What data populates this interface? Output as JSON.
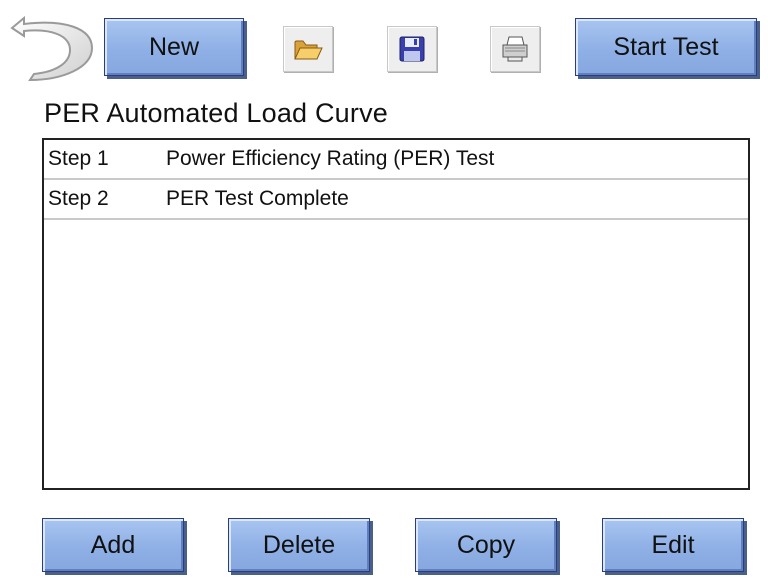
{
  "toolbar": {
    "back_icon": "back-arrow-icon",
    "new_label": "New",
    "open_icon": "folder-open-icon",
    "save_icon": "floppy-disk-icon",
    "print_icon": "printer-icon",
    "start_label": "Start Test"
  },
  "page": {
    "title": "PER Automated Load Curve"
  },
  "steps": [
    {
      "step": "Step 1",
      "description": "Power Efficiency Rating (PER) Test"
    },
    {
      "step": "Step 2",
      "description": "PER Test Complete"
    }
  ],
  "actions": {
    "add_label": "Add",
    "delete_label": "Delete",
    "copy_label": "Copy",
    "edit_label": "Edit"
  },
  "colors": {
    "button_blue": "#8fb0e6",
    "folder_yellow": "#f2c25a",
    "floppy_blue": "#3a3fae"
  }
}
